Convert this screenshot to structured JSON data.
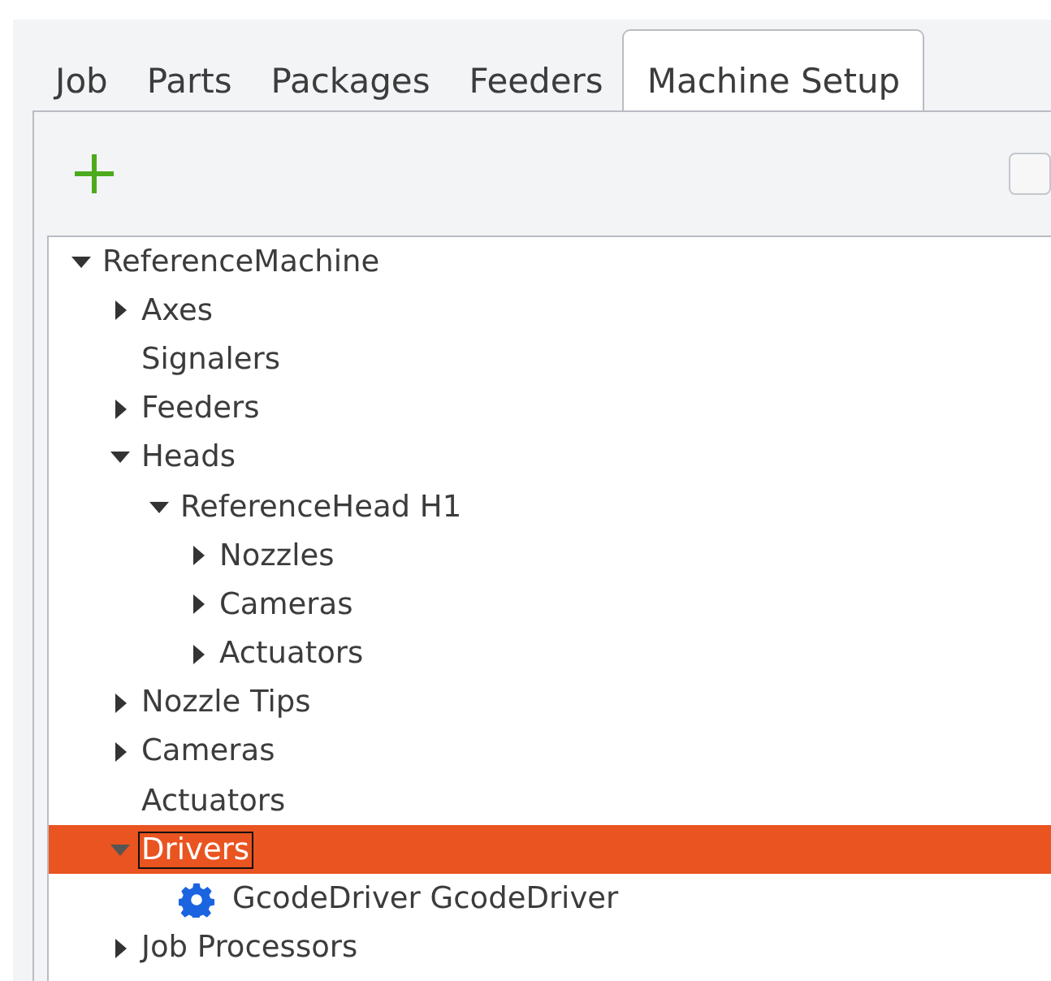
{
  "tabs": [
    {
      "label": "Job",
      "selected": false
    },
    {
      "label": "Parts",
      "selected": false
    },
    {
      "label": "Packages",
      "selected": false
    },
    {
      "label": "Feeders",
      "selected": false
    },
    {
      "label": "Machine Setup",
      "selected": true
    }
  ],
  "toolbar": {
    "checked": false
  },
  "tree": [
    {
      "label": "ReferenceMachine",
      "expanded": true,
      "selected": false,
      "children": [
        {
          "label": "Axes",
          "expanded": false,
          "selected": false
        },
        {
          "label": "Signalers",
          "selected": false
        },
        {
          "label": "Feeders",
          "expanded": false,
          "selected": false
        },
        {
          "label": "Heads",
          "expanded": true,
          "selected": false,
          "children": [
            {
              "label": "ReferenceHead H1",
              "expanded": true,
              "selected": false,
              "children": [
                {
                  "label": "Nozzles",
                  "expanded": false,
                  "selected": false
                },
                {
                  "label": "Cameras",
                  "expanded": false,
                  "selected": false
                },
                {
                  "label": "Actuators",
                  "expanded": false,
                  "selected": false
                }
              ]
            }
          ]
        },
        {
          "label": "Nozzle Tips",
          "expanded": false,
          "selected": false
        },
        {
          "label": "Cameras",
          "expanded": false,
          "selected": false
        },
        {
          "label": "Actuators",
          "selected": false
        },
        {
          "label": "Drivers",
          "expanded": true,
          "selected": true,
          "children": [
            {
              "label": "GcodeDriver GcodeDriver",
              "kind": "driver",
              "selected": false
            }
          ]
        },
        {
          "label": "Job Processors",
          "expanded": false,
          "selected": false
        }
      ]
    }
  ]
}
